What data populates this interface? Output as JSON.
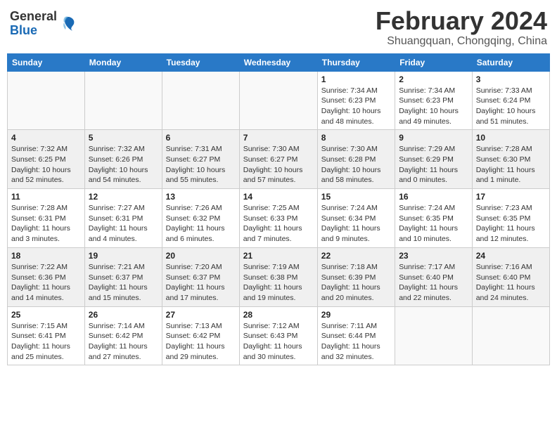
{
  "header": {
    "logo_general": "General",
    "logo_blue": "Blue",
    "month_title": "February 2024",
    "location": "Shuangquan, Chongqing, China"
  },
  "days_of_week": [
    "Sunday",
    "Monday",
    "Tuesday",
    "Wednesday",
    "Thursday",
    "Friday",
    "Saturday"
  ],
  "weeks": [
    [
      {
        "day": "",
        "info": ""
      },
      {
        "day": "",
        "info": ""
      },
      {
        "day": "",
        "info": ""
      },
      {
        "day": "",
        "info": ""
      },
      {
        "day": "1",
        "info": "Sunrise: 7:34 AM\nSunset: 6:23 PM\nDaylight: 10 hours\nand 48 minutes."
      },
      {
        "day": "2",
        "info": "Sunrise: 7:34 AM\nSunset: 6:23 PM\nDaylight: 10 hours\nand 49 minutes."
      },
      {
        "day": "3",
        "info": "Sunrise: 7:33 AM\nSunset: 6:24 PM\nDaylight: 10 hours\nand 51 minutes."
      }
    ],
    [
      {
        "day": "4",
        "info": "Sunrise: 7:32 AM\nSunset: 6:25 PM\nDaylight: 10 hours\nand 52 minutes."
      },
      {
        "day": "5",
        "info": "Sunrise: 7:32 AM\nSunset: 6:26 PM\nDaylight: 10 hours\nand 54 minutes."
      },
      {
        "day": "6",
        "info": "Sunrise: 7:31 AM\nSunset: 6:27 PM\nDaylight: 10 hours\nand 55 minutes."
      },
      {
        "day": "7",
        "info": "Sunrise: 7:30 AM\nSunset: 6:27 PM\nDaylight: 10 hours\nand 57 minutes."
      },
      {
        "day": "8",
        "info": "Sunrise: 7:30 AM\nSunset: 6:28 PM\nDaylight: 10 hours\nand 58 minutes."
      },
      {
        "day": "9",
        "info": "Sunrise: 7:29 AM\nSunset: 6:29 PM\nDaylight: 11 hours\nand 0 minutes."
      },
      {
        "day": "10",
        "info": "Sunrise: 7:28 AM\nSunset: 6:30 PM\nDaylight: 11 hours\nand 1 minute."
      }
    ],
    [
      {
        "day": "11",
        "info": "Sunrise: 7:28 AM\nSunset: 6:31 PM\nDaylight: 11 hours\nand 3 minutes."
      },
      {
        "day": "12",
        "info": "Sunrise: 7:27 AM\nSunset: 6:31 PM\nDaylight: 11 hours\nand 4 minutes."
      },
      {
        "day": "13",
        "info": "Sunrise: 7:26 AM\nSunset: 6:32 PM\nDaylight: 11 hours\nand 6 minutes."
      },
      {
        "day": "14",
        "info": "Sunrise: 7:25 AM\nSunset: 6:33 PM\nDaylight: 11 hours\nand 7 minutes."
      },
      {
        "day": "15",
        "info": "Sunrise: 7:24 AM\nSunset: 6:34 PM\nDaylight: 11 hours\nand 9 minutes."
      },
      {
        "day": "16",
        "info": "Sunrise: 7:24 AM\nSunset: 6:35 PM\nDaylight: 11 hours\nand 10 minutes."
      },
      {
        "day": "17",
        "info": "Sunrise: 7:23 AM\nSunset: 6:35 PM\nDaylight: 11 hours\nand 12 minutes."
      }
    ],
    [
      {
        "day": "18",
        "info": "Sunrise: 7:22 AM\nSunset: 6:36 PM\nDaylight: 11 hours\nand 14 minutes."
      },
      {
        "day": "19",
        "info": "Sunrise: 7:21 AM\nSunset: 6:37 PM\nDaylight: 11 hours\nand 15 minutes."
      },
      {
        "day": "20",
        "info": "Sunrise: 7:20 AM\nSunset: 6:37 PM\nDaylight: 11 hours\nand 17 minutes."
      },
      {
        "day": "21",
        "info": "Sunrise: 7:19 AM\nSunset: 6:38 PM\nDaylight: 11 hours\nand 19 minutes."
      },
      {
        "day": "22",
        "info": "Sunrise: 7:18 AM\nSunset: 6:39 PM\nDaylight: 11 hours\nand 20 minutes."
      },
      {
        "day": "23",
        "info": "Sunrise: 7:17 AM\nSunset: 6:40 PM\nDaylight: 11 hours\nand 22 minutes."
      },
      {
        "day": "24",
        "info": "Sunrise: 7:16 AM\nSunset: 6:40 PM\nDaylight: 11 hours\nand 24 minutes."
      }
    ],
    [
      {
        "day": "25",
        "info": "Sunrise: 7:15 AM\nSunset: 6:41 PM\nDaylight: 11 hours\nand 25 minutes."
      },
      {
        "day": "26",
        "info": "Sunrise: 7:14 AM\nSunset: 6:42 PM\nDaylight: 11 hours\nand 27 minutes."
      },
      {
        "day": "27",
        "info": "Sunrise: 7:13 AM\nSunset: 6:42 PM\nDaylight: 11 hours\nand 29 minutes."
      },
      {
        "day": "28",
        "info": "Sunrise: 7:12 AM\nSunset: 6:43 PM\nDaylight: 11 hours\nand 30 minutes."
      },
      {
        "day": "29",
        "info": "Sunrise: 7:11 AM\nSunset: 6:44 PM\nDaylight: 11 hours\nand 32 minutes."
      },
      {
        "day": "",
        "info": ""
      },
      {
        "day": "",
        "info": ""
      }
    ]
  ]
}
